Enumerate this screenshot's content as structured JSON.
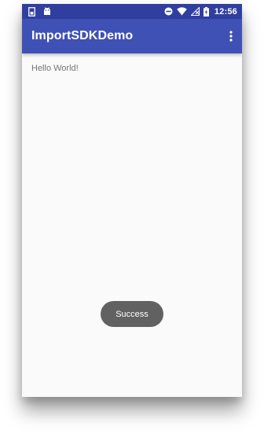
{
  "status_bar": {
    "time": "12:56",
    "icons": [
      "sim-card-icon",
      "android-icon",
      "do-not-disturb-icon",
      "wifi-icon",
      "no-signal-icon",
      "battery-charging-icon"
    ]
  },
  "app_bar": {
    "title": "ImportSDKDemo",
    "overflow_icon": "more-vert-icon"
  },
  "main": {
    "message": "Hello World!"
  },
  "toast": {
    "text": "Success"
  },
  "colors": {
    "primary": "#3f51b5",
    "primary_dark": "#303f9f",
    "background": "#fafafa",
    "toast": "#616161"
  }
}
